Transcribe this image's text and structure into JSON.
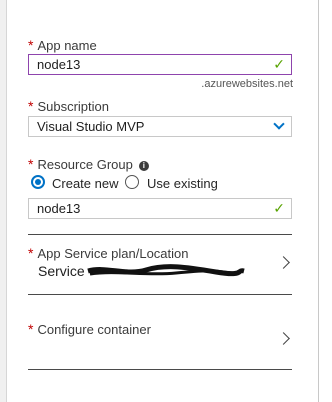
{
  "app_name": {
    "label": "App name",
    "value": "node13",
    "suffix": ".azurewebsites.net",
    "valid_icon": "check-icon"
  },
  "subscription": {
    "label": "Subscription",
    "selected": "Visual Studio MVP",
    "dropdown_icon": "chevron-down-icon"
  },
  "resource_group": {
    "label": "Resource Group",
    "info_icon": "info-icon",
    "options": [
      {
        "label": "Create new",
        "selected": true
      },
      {
        "label": "Use existing",
        "selected": false
      }
    ],
    "value": "node13",
    "valid_icon": "check-icon"
  },
  "app_service_plan": {
    "label": "App Service plan/Location",
    "value": "Service"
  },
  "configure_container": {
    "label": "Configure container"
  },
  "colors": {
    "accent": "#0072c6",
    "required": "#c00000",
    "valid": "#57a300",
    "focus_border": "#8e44ad"
  }
}
